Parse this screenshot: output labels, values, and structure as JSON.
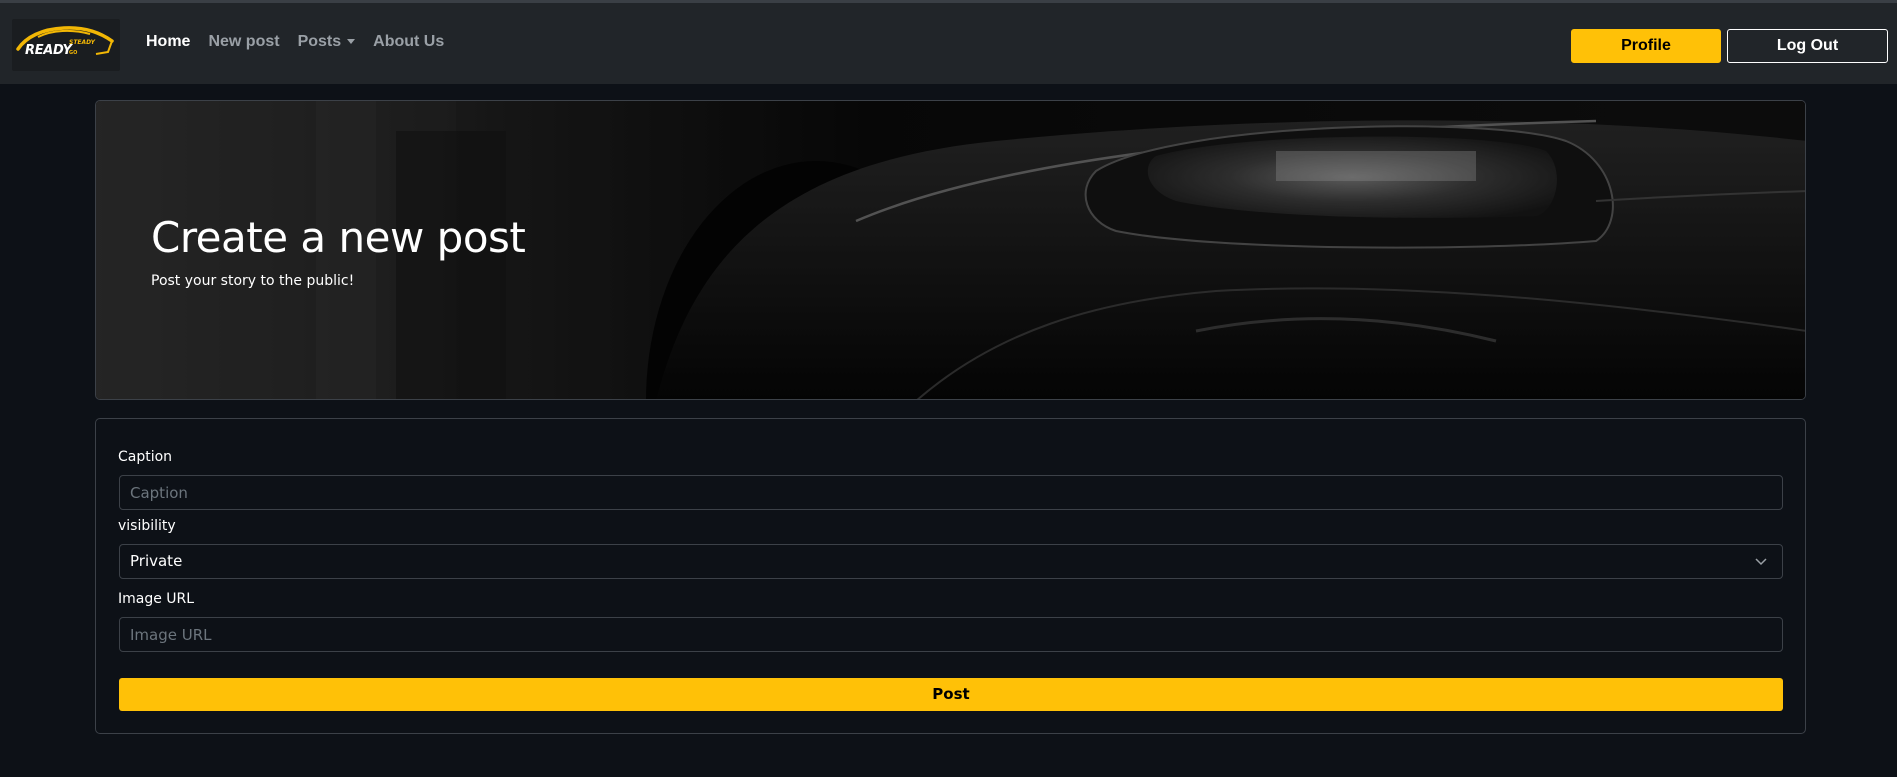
{
  "navbar": {
    "logo_text": "READY",
    "logo_text_small": "STEADY",
    "logo_text_tiny": "GO",
    "links": [
      {
        "label": "Home",
        "active": true
      },
      {
        "label": "New post",
        "active": false
      },
      {
        "label": "Posts",
        "active": false
      },
      {
        "label": "About Us",
        "active": false
      }
    ],
    "profile_label": "Profile",
    "logout_label": "Log Out"
  },
  "hero": {
    "title": "Create a new post",
    "subtitle": "Post your story to the public!"
  },
  "form": {
    "caption_label": "Caption",
    "caption_placeholder": "Caption",
    "visibility_label": "visibility",
    "visibility_value": "Private",
    "image_url_label": "Image URL",
    "image_url_placeholder": "Image URL",
    "submit_label": "Post"
  },
  "colors": {
    "accent": "#ffc107",
    "navbar_bg": "#212529",
    "page_bg": "#0d1117"
  }
}
